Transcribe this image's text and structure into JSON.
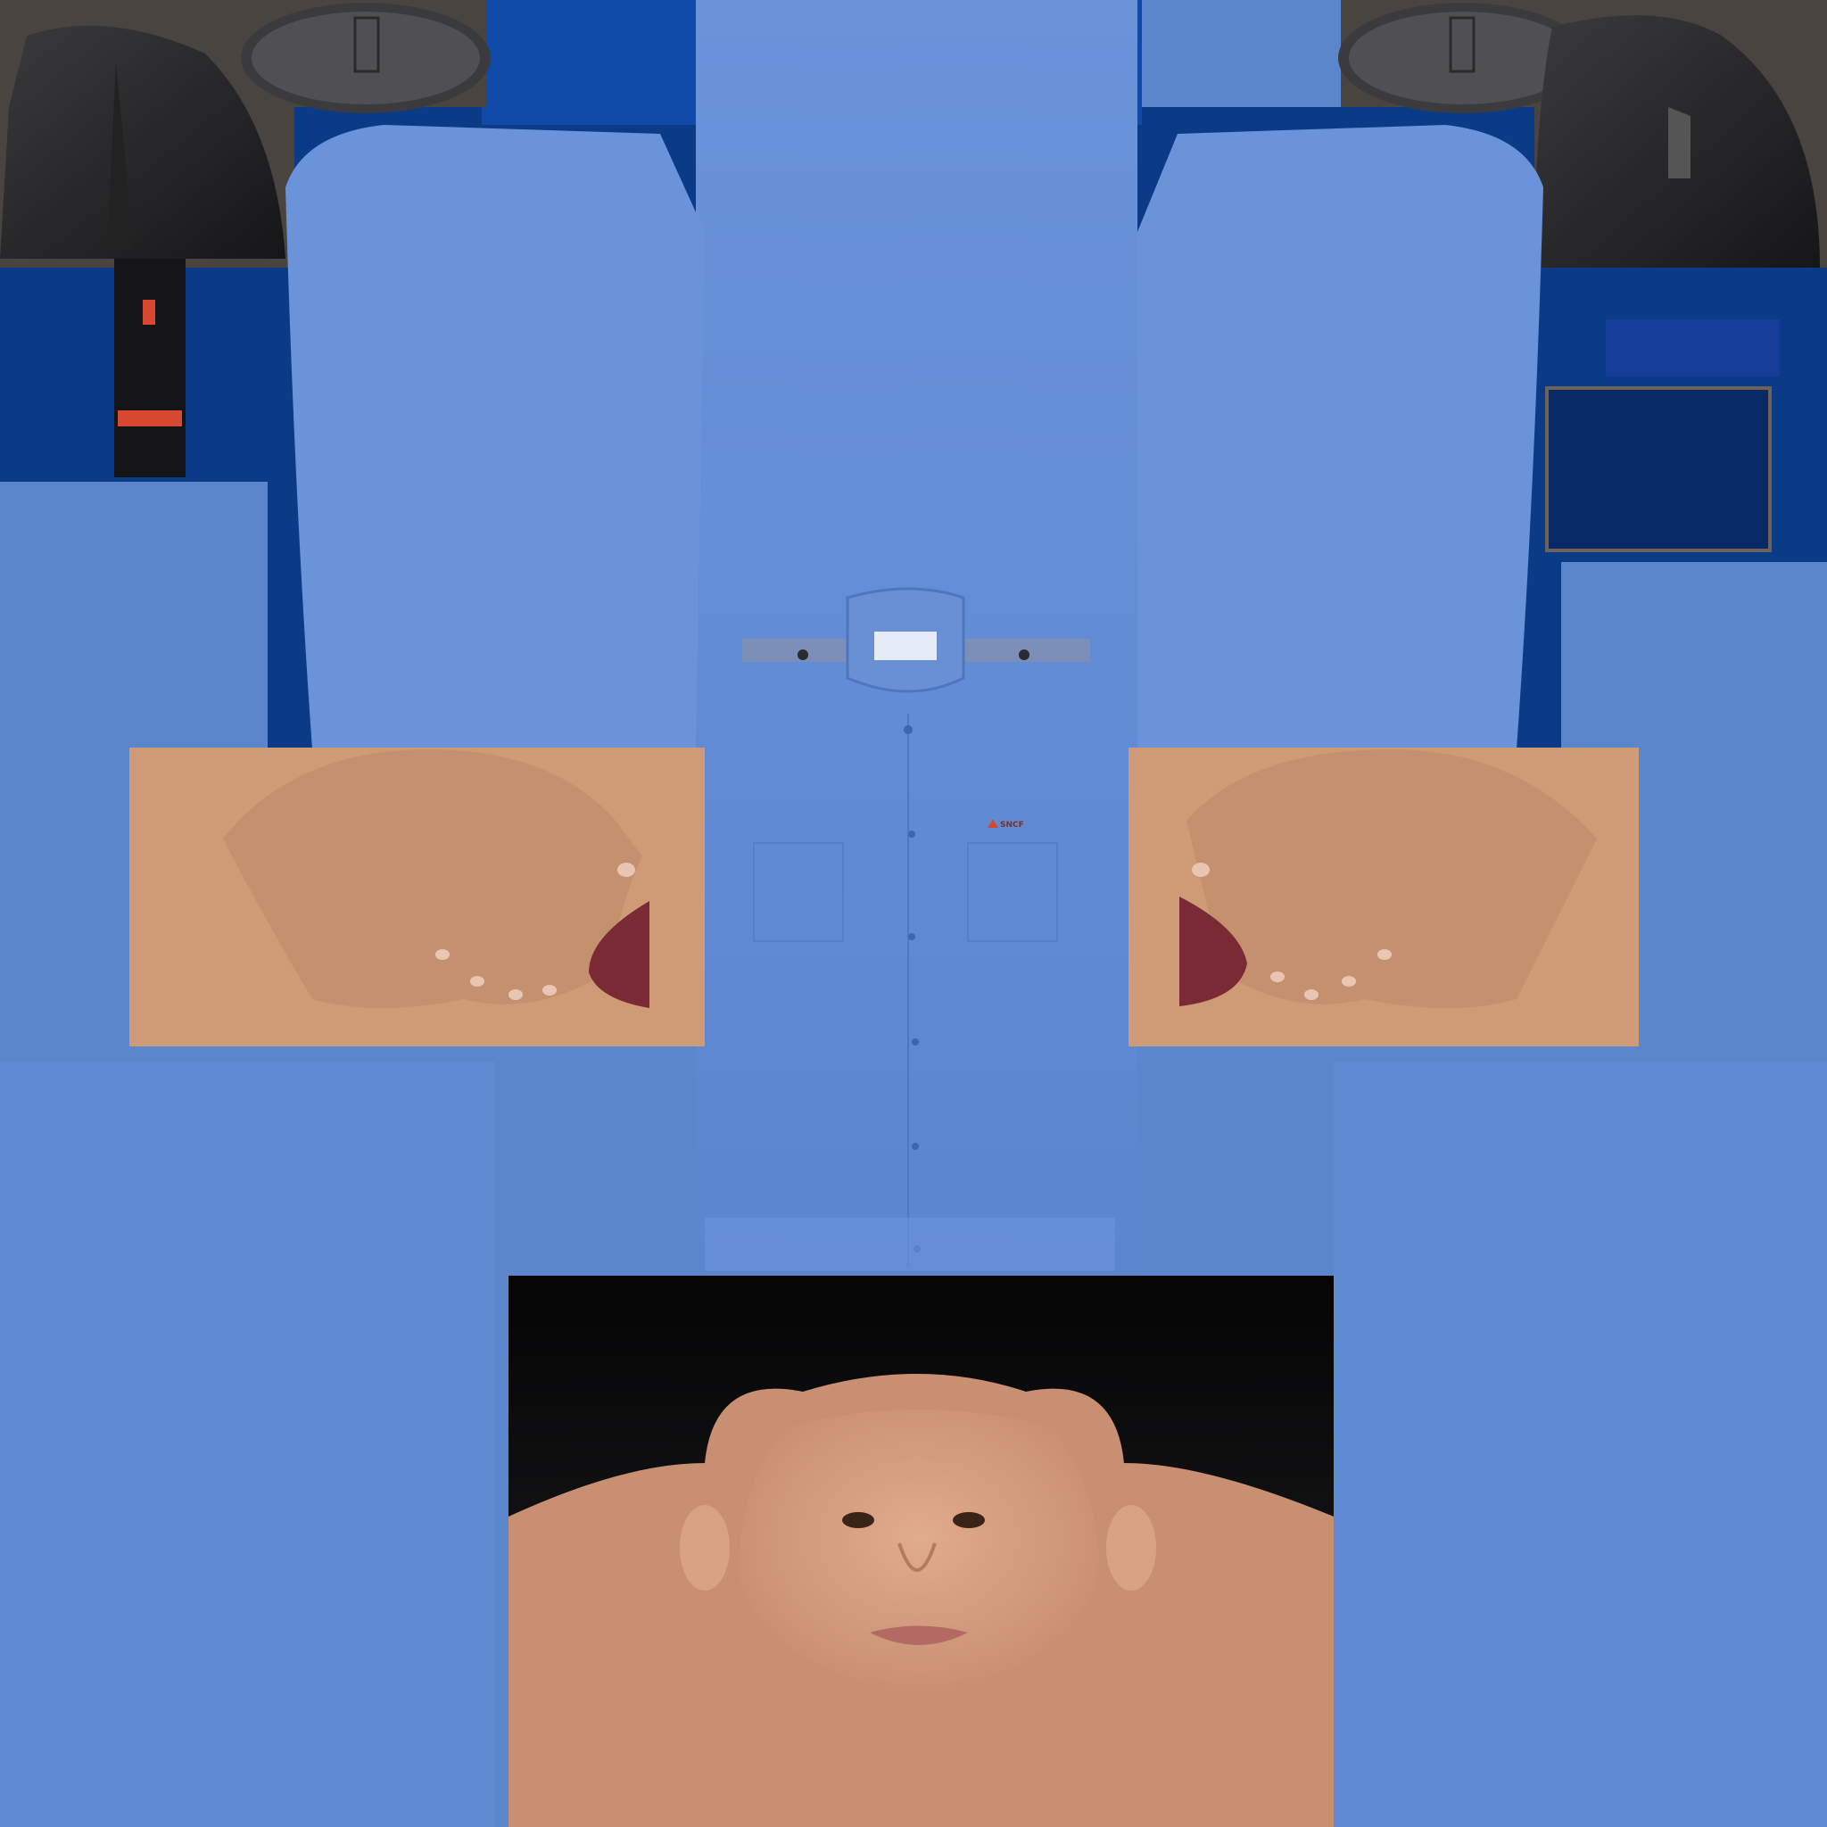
{
  "texture": {
    "colors": {
      "shirt": "#5e89d2",
      "shirt_light": "#6c95dc",
      "shirt_dark": "#4f79c4",
      "navy": "#0b3a86",
      "deep_navy": "#072a66",
      "skin": "#cf9a76",
      "skin_dark": "#b07556",
      "hair": "#0c0c0e",
      "boot": "#2a2a2c",
      "brown_bg": "#4a4440",
      "accent_red": "#d84830",
      "mouth": "#7a2a34"
    },
    "shirt_logo_text": "SNCF",
    "icons": {
      "left_boot": "boot-shape",
      "right_boot": "boot-shape",
      "badge": "collar-badge"
    }
  }
}
